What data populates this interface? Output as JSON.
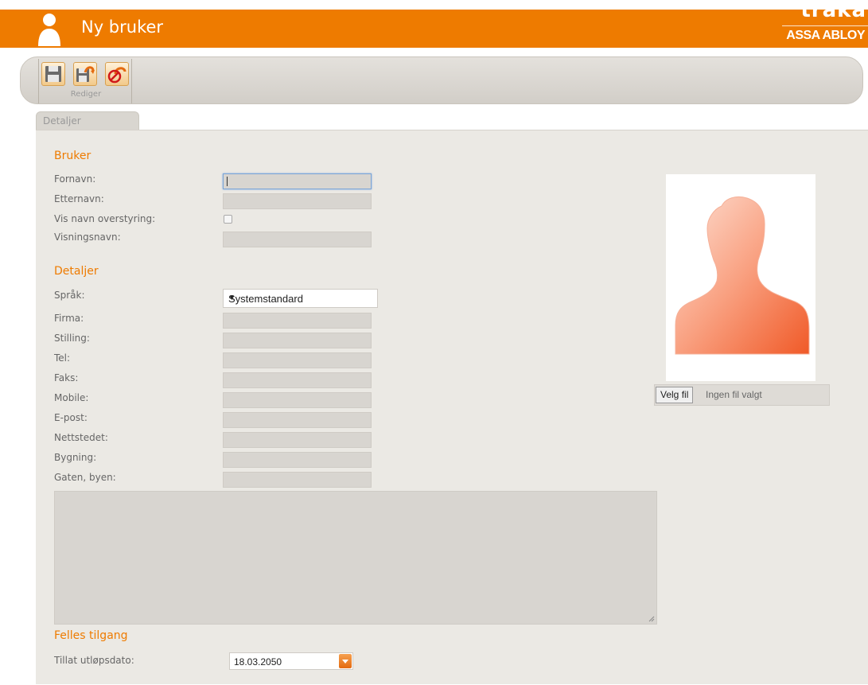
{
  "header": {
    "title": "Ny bruker",
    "brand_top": "traka",
    "brand_bottom": "ASSA ABLOY",
    "accent_color": "#ee7b00"
  },
  "toolbar": {
    "group_label": "Rediger",
    "buttons": [
      {
        "icon": "save-icon"
      },
      {
        "icon": "save-and-close-icon"
      },
      {
        "icon": "cancel-icon"
      }
    ]
  },
  "tabs": [
    {
      "label": "Detaljer",
      "active": true
    }
  ],
  "bruker": {
    "title": "Bruker",
    "fornavn_label": "Fornavn:",
    "etternavn_label": "Etternavn:",
    "vis_navn_label": "Vis navn overstyring:",
    "visningsnavn_label": "Visningsnavn:"
  },
  "detaljer": {
    "title": "Detaljer",
    "sprak_label": "Språk:",
    "sprak_value": "Systemstandard",
    "firma_label": "Firma:",
    "stilling_label": "Stilling:",
    "tel_label": "Tel:",
    "faks_label": "Faks:",
    "mobile_label": "Mobile:",
    "epost_label": "E-post:",
    "nettstedet_label": "Nettstedet:",
    "bygning_label": "Bygning:",
    "gaten_label": "Gaten, byen:"
  },
  "photo": {
    "file_button": "Velg fil",
    "file_status": "Ingen fil valgt"
  },
  "felles": {
    "title": "Felles tilgang",
    "utlop_label": "Tillat utløpsdato:",
    "utlop_value": "18.03.2050"
  }
}
